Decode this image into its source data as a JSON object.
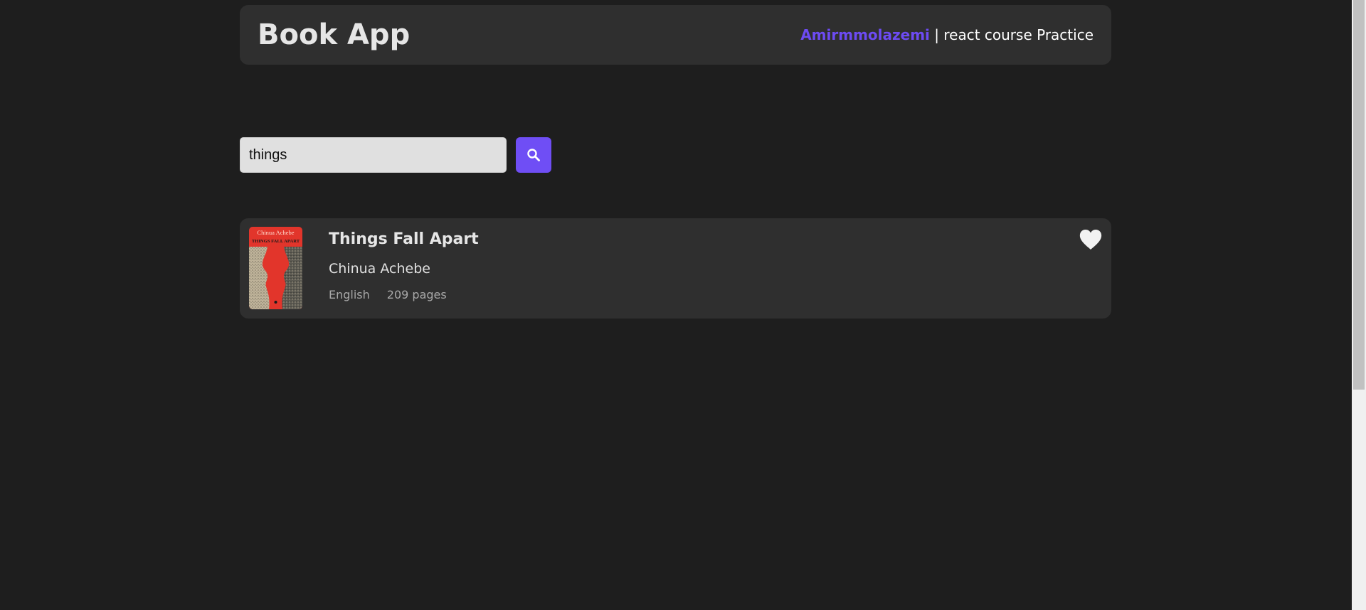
{
  "header": {
    "title": "Book App",
    "author_name": "Amirmmolazemi",
    "tagline": " | react course Practice"
  },
  "search": {
    "value": "things",
    "placeholder": "",
    "button_icon": "search-icon"
  },
  "results": [
    {
      "title": "Things Fall Apart",
      "author": "Chinua Achebe",
      "language": "English",
      "pages": "209 pages",
      "cover": {
        "author_text": "Chinua Achebe",
        "title_text": "THINGS FALL APART"
      },
      "favorite_icon": "heart-icon"
    }
  ],
  "colors": {
    "background": "#1e1e1e",
    "panel": "#2f2f2f",
    "accent": "#6f4ef5"
  }
}
